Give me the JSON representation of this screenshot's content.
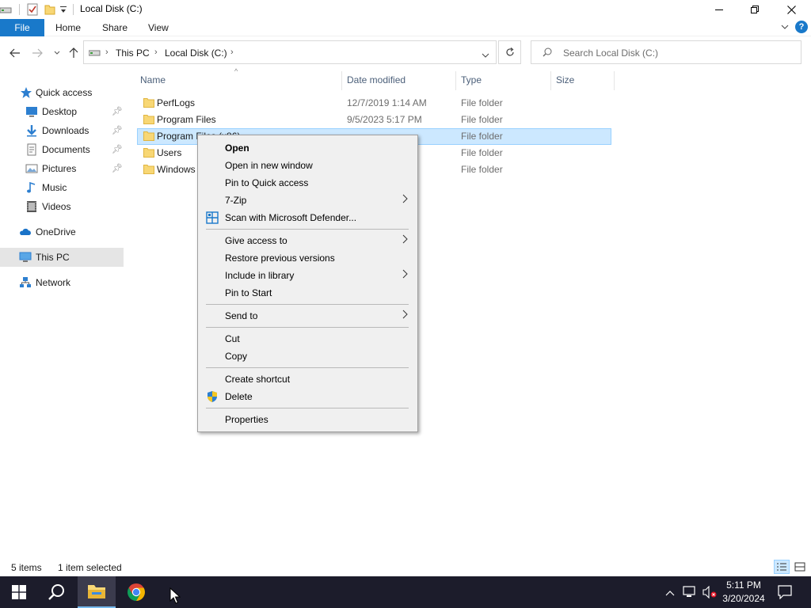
{
  "window": {
    "title": "Local Disk (C:)"
  },
  "ribbon": {
    "tabs": [
      "File",
      "Home",
      "Share",
      "View"
    ]
  },
  "address": {
    "crumbs": [
      "This PC",
      "Local Disk (C:)"
    ]
  },
  "search": {
    "placeholder": "Search Local Disk (C:)"
  },
  "nav": {
    "quick_access": "Quick access",
    "items": [
      {
        "label": "Desktop",
        "icon": "desktop-icon",
        "pinned": true
      },
      {
        "label": "Downloads",
        "icon": "downloads-icon",
        "pinned": true
      },
      {
        "label": "Documents",
        "icon": "documents-icon",
        "pinned": true
      },
      {
        "label": "Pictures",
        "icon": "pictures-icon",
        "pinned": true
      },
      {
        "label": "Music",
        "icon": "music-icon",
        "pinned": false
      },
      {
        "label": "Videos",
        "icon": "videos-icon",
        "pinned": false
      }
    ],
    "onedrive": "OneDrive",
    "this_pc": "This PC",
    "network": "Network"
  },
  "columns": {
    "name": "Name",
    "date": "Date modified",
    "type": "Type",
    "size": "Size"
  },
  "files": [
    {
      "name": "PerfLogs",
      "date": "12/7/2019 1:14 AM",
      "type": "File folder"
    },
    {
      "name": "Program Files",
      "date": "9/5/2023 5:17 PM",
      "type": "File folder"
    },
    {
      "name": "Program Files (x86)",
      "date": "",
      "type": "File folder"
    },
    {
      "name": "Users",
      "date": "",
      "type": "File folder"
    },
    {
      "name": "Windows",
      "date": "",
      "type": "File folder"
    }
  ],
  "context_menu": {
    "items": [
      {
        "label": "Open",
        "bold": true
      },
      {
        "label": "Open in new window"
      },
      {
        "label": "Pin to Quick access"
      },
      {
        "label": "7-Zip",
        "submenu": true
      },
      {
        "label": "Scan with Microsoft Defender...",
        "icon": "defender-icon"
      },
      {
        "label": "Give access to",
        "submenu": true
      },
      {
        "label": "Restore previous versions"
      },
      {
        "label": "Include in library",
        "submenu": true
      },
      {
        "label": "Pin to Start"
      },
      {
        "label": "Send to",
        "submenu": true
      },
      {
        "label": "Cut"
      },
      {
        "label": "Copy"
      },
      {
        "label": "Create shortcut"
      },
      {
        "label": "Delete",
        "icon": "shield-icon"
      },
      {
        "label": "Properties"
      }
    ]
  },
  "status": {
    "count": "5 items",
    "selection": "1 item selected"
  },
  "taskbar": {
    "time": "5:11 PM",
    "date": "3/20/2024"
  },
  "colors": {
    "accent": "#1979ca",
    "selection_bg": "#cce8ff",
    "selection_border": "#99d1ff",
    "taskbar": "#1c1c2b",
    "folder": "#f8d775"
  }
}
